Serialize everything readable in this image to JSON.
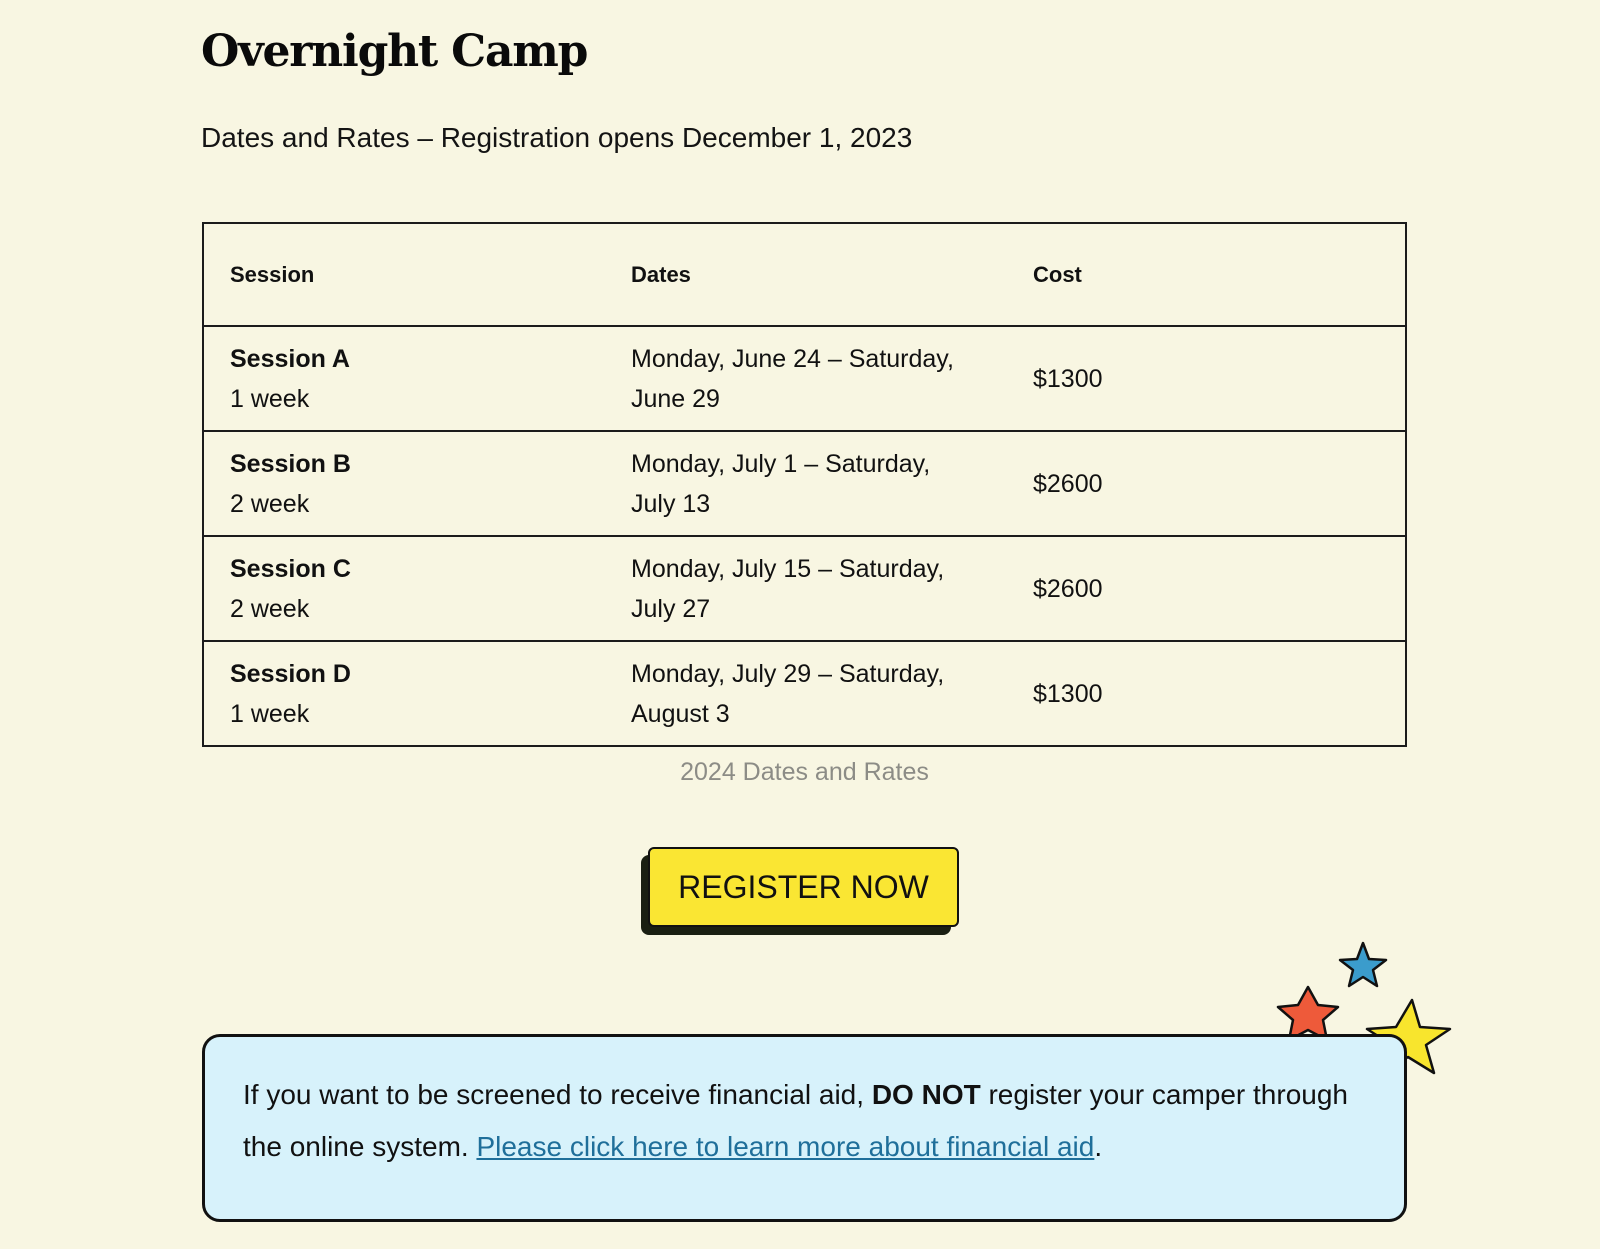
{
  "page": {
    "title": "Overnight Camp",
    "subtitle": "Dates and Rates – Registration opens December 1, 2023"
  },
  "table": {
    "headers": {
      "session": "Session",
      "dates": "Dates",
      "cost": "Cost"
    },
    "rows": [
      {
        "session": "Session A",
        "length": "1 week",
        "dates": "Monday, June 24 – Saturday, June 29",
        "cost": "$1300"
      },
      {
        "session": "Session B",
        "length": "2 week",
        "dates": "Monday, July 1 – Saturday, July 13",
        "cost": "$2600"
      },
      {
        "session": "Session C",
        "length": "2 week",
        "dates": "Monday, July 15 – Saturday, July 27",
        "cost": "$2600"
      },
      {
        "session": "Session D",
        "length": "1 week",
        "dates": "Monday, July 29 – Saturday, August 3",
        "cost": "$1300"
      }
    ],
    "caption": "2024 Dates and Rates"
  },
  "register": {
    "label": "REGISTER NOW",
    "color": "#fae633"
  },
  "financial_aid": {
    "text_before": "If you want to be screened to receive financial aid, ",
    "emphasis": "DO NOT",
    "text_after": " register your camper through the online system. ",
    "link_text": "Please click here to learn more about financial aid",
    "text_end": ".",
    "background": "#d7f2fb"
  },
  "decorations": {
    "icons": [
      "blue-star-icon",
      "red-star-icon",
      "yellow-star-icon"
    ],
    "colors": {
      "blue": "#3b9ccc",
      "red": "#ee5a3a",
      "yellow": "#f8e52d"
    }
  }
}
